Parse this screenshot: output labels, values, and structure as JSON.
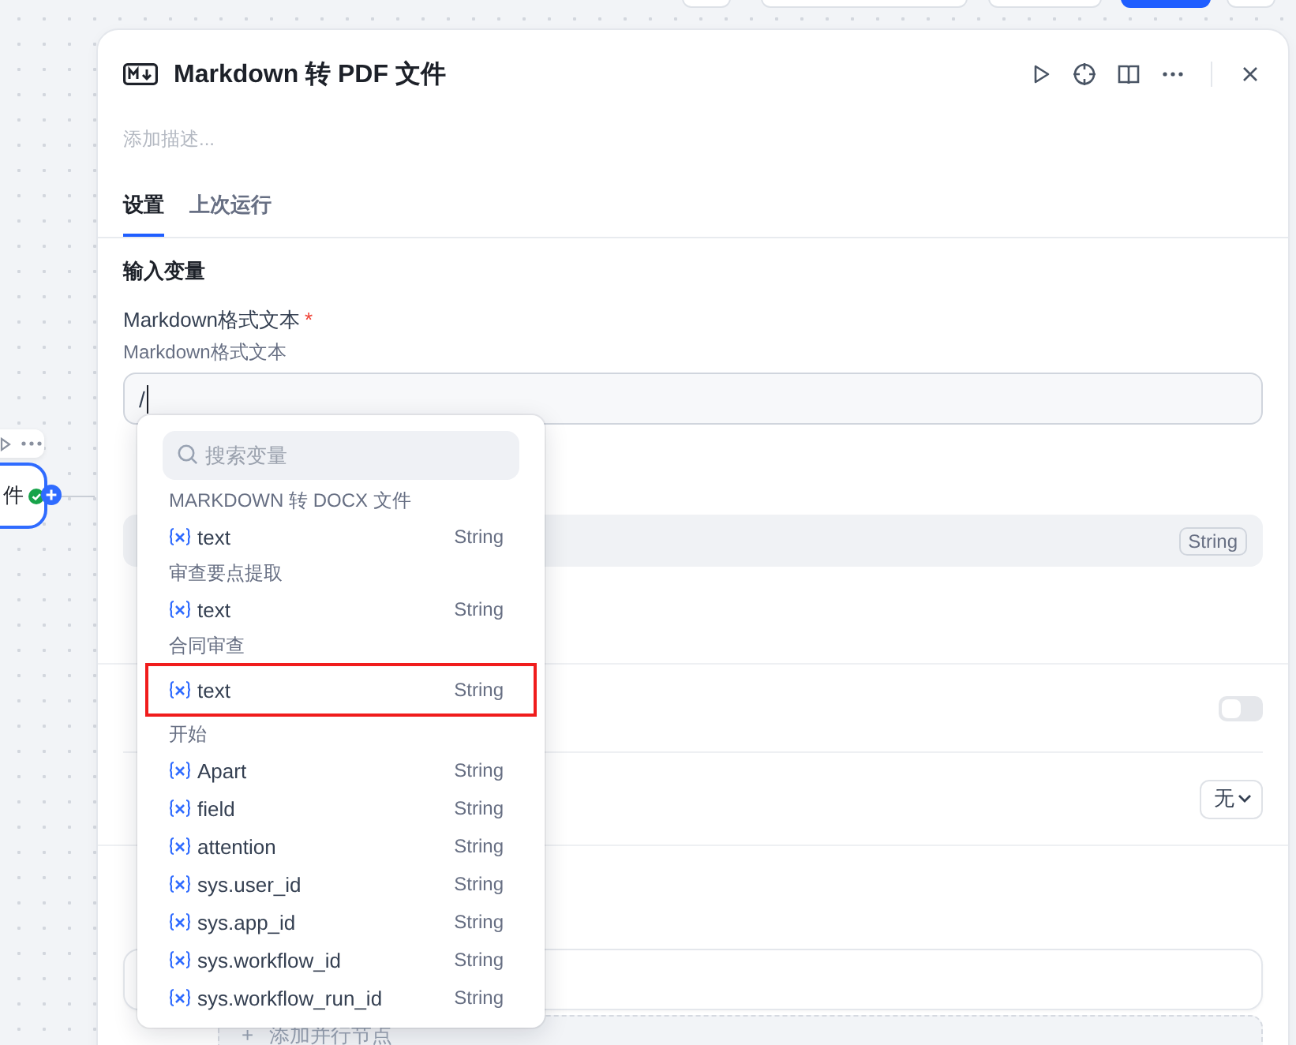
{
  "toolbar_buttons": [
    {
      "kind": "outline"
    },
    {
      "kind": "outline"
    },
    {
      "kind": "outline"
    },
    {
      "kind": "primary"
    },
    {
      "kind": "outline"
    }
  ],
  "canvas_node": {
    "label": "件"
  },
  "panel": {
    "title": "Markdown 转 PDF 文件",
    "description_placeholder": "添加描述...",
    "tabs": [
      {
        "label": "设置",
        "selected": true
      },
      {
        "label": "上次运行",
        "selected": false
      }
    ],
    "input_variables": {
      "heading": "输入变量",
      "fields": [
        {
          "label": "Markdown格式文本",
          "required_mark": "*",
          "description": "Markdown格式文本",
          "value": "/"
        }
      ]
    },
    "output_filename": {
      "type": "String"
    },
    "retry": {
      "on": false
    },
    "error_handling": {
      "value": "无"
    },
    "next_step": {
      "add_parallel": "添加并行节点",
      "add_icon": "+"
    }
  },
  "popup": {
    "search_placeholder": "搜索变量",
    "groups": [
      {
        "title": "MARKDOWN 转 DOCX 文件",
        "items": [
          {
            "name": "text",
            "type": "String",
            "highlighted": false
          }
        ]
      },
      {
        "title": "审查要点提取",
        "items": [
          {
            "name": "text",
            "type": "String",
            "highlighted": false
          }
        ]
      },
      {
        "title": "合同审查",
        "items": [
          {
            "name": "text",
            "type": "String",
            "highlighted": true
          }
        ]
      },
      {
        "title": "开始",
        "items": [
          {
            "name": "Apart",
            "type": "String",
            "highlighted": false
          },
          {
            "name": "field",
            "type": "String",
            "highlighted": false
          },
          {
            "name": "attention",
            "type": "String",
            "highlighted": false
          },
          {
            "name": "sys.user_id",
            "type": "String",
            "highlighted": false
          },
          {
            "name": "sys.app_id",
            "type": "String",
            "highlighted": false
          },
          {
            "name": "sys.workflow_id",
            "type": "String",
            "highlighted": false
          },
          {
            "name": "sys.workflow_run_id",
            "type": "String",
            "highlighted": false
          }
        ]
      }
    ]
  }
}
